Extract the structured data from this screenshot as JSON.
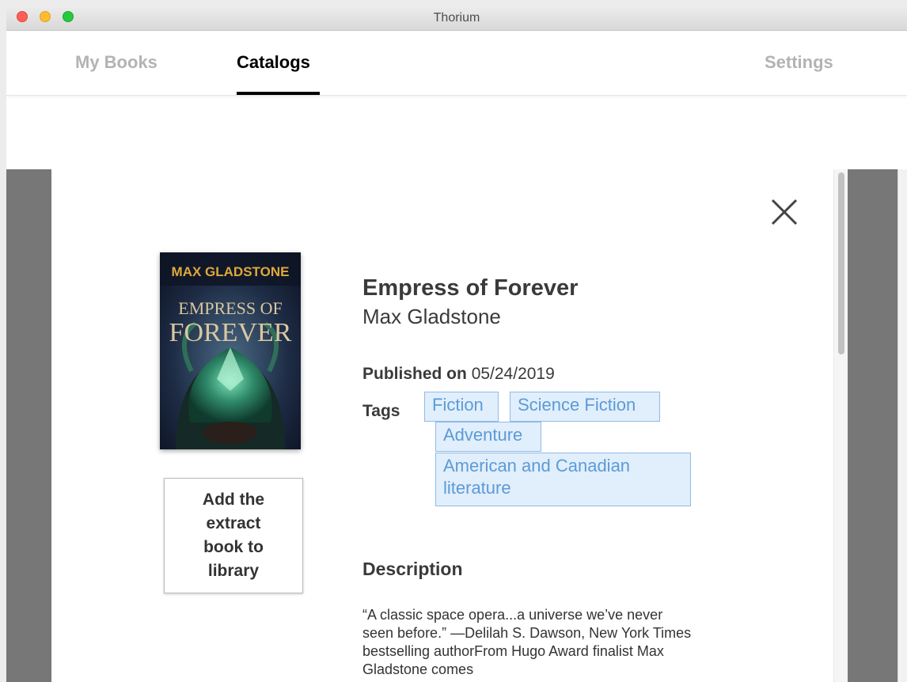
{
  "window": {
    "title": "Thorium"
  },
  "nav": {
    "tabs": [
      {
        "label": "My Books",
        "active": false
      },
      {
        "label": "Catalogs",
        "active": true
      },
      {
        "label": "Settings",
        "active": false
      }
    ]
  },
  "book": {
    "cover": {
      "author_text": "MAX GLADSTONE",
      "title_line1": "EMPRESS OF",
      "title_line2": "FOREVER"
    },
    "title": "Empress of Forever",
    "author": "Max Gladstone",
    "published_label": "Published on",
    "published_date": "05/24/2019",
    "tags_label": "Tags",
    "tags": [
      "Fiction",
      "Science Fiction",
      "Adventure",
      "American and Canadian literature"
    ],
    "add_button": "Add the extract book to library",
    "description_heading": "Description",
    "description": "“A classic space opera...a universe we’ve never seen before.” —Delilah S. Dawson, New York Times bestselling authorFrom Hugo Award finalist Max Gladstone comes"
  },
  "colors": {
    "tag_background": "#e1eefb",
    "tag_border": "#8fbbe6",
    "tag_text": "#5b9bd8",
    "backdrop": "#777777",
    "active_tab": "#000000",
    "inactive_tab": "#b3b3b3"
  },
  "icons": {
    "close": "close-icon",
    "traffic_lights": [
      "close-window-icon",
      "minimize-window-icon",
      "zoom-window-icon"
    ]
  }
}
